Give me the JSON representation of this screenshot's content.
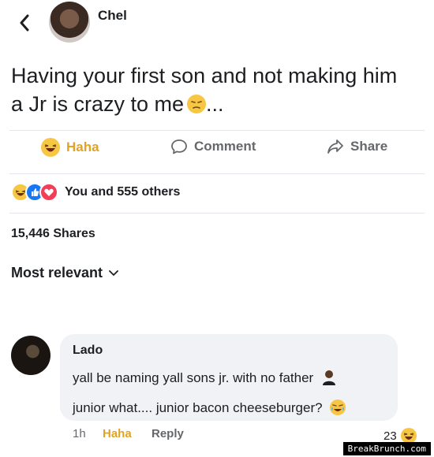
{
  "header": {
    "author": "Chel"
  },
  "post": {
    "text": "Having your first son and not making him a Jr is crazy to me",
    "ellipsis": "..."
  },
  "actions": {
    "haha": "Haha",
    "comment": "Comment",
    "share": "Share"
  },
  "reactions": {
    "summary": "You and 555 others"
  },
  "shares": "15,446 Shares",
  "sort": {
    "label": "Most relevant"
  },
  "comment": {
    "author": "Lado",
    "line1": "yall be naming yall sons jr. with no father",
    "line2": "junior what.... junior bacon cheeseburger?",
    "time": "1h",
    "haha": "Haha",
    "reply": "Reply",
    "reaction_count": "23"
  },
  "watermark": "BreakBrunch.com",
  "colors": {
    "haha": "#e0a325",
    "muted": "#65676b",
    "bubble": "#f0f2f5"
  }
}
